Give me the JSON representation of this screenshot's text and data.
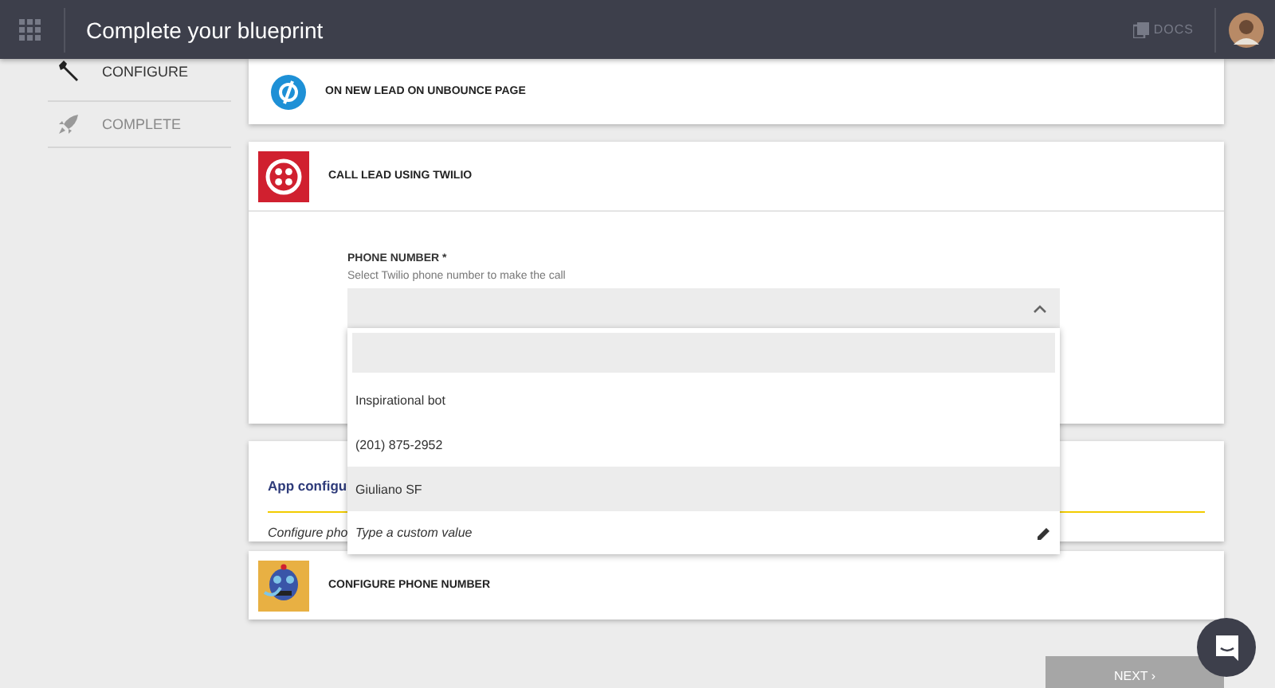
{
  "header": {
    "title": "Complete your blueprint",
    "docs": "DOCS"
  },
  "sidebar": {
    "items": [
      {
        "label": "CONFIGURE",
        "selected": true
      },
      {
        "label": "COMPLETE",
        "selected": false
      }
    ]
  },
  "steps": [
    {
      "title": "ON NEW LEAD ON UNBOUNCE PAGE"
    },
    {
      "title": "CALL LEAD USING TWILIO",
      "field": {
        "label": "PHONE NUMBER",
        "required": "*",
        "help": "Select Twilio phone number to make the call",
        "expanded": true,
        "options": [
          {
            "kind": "option",
            "label": "Inspirational bot",
            "selected": false
          },
          {
            "kind": "option",
            "label": "(201) 875-2952",
            "selected": false
          },
          {
            "kind": "option",
            "label": "Giuliano SF",
            "selected": true
          },
          {
            "kind": "custom",
            "label": "Type a custom value",
            "selected": false
          }
        ]
      }
    }
  ],
  "app_config": {
    "title": "App configu",
    "description": "Configure pho"
  },
  "last_step": {
    "title": "CONFIGURE PHONE NUMBER"
  },
  "next_button": "NEXT ›"
}
